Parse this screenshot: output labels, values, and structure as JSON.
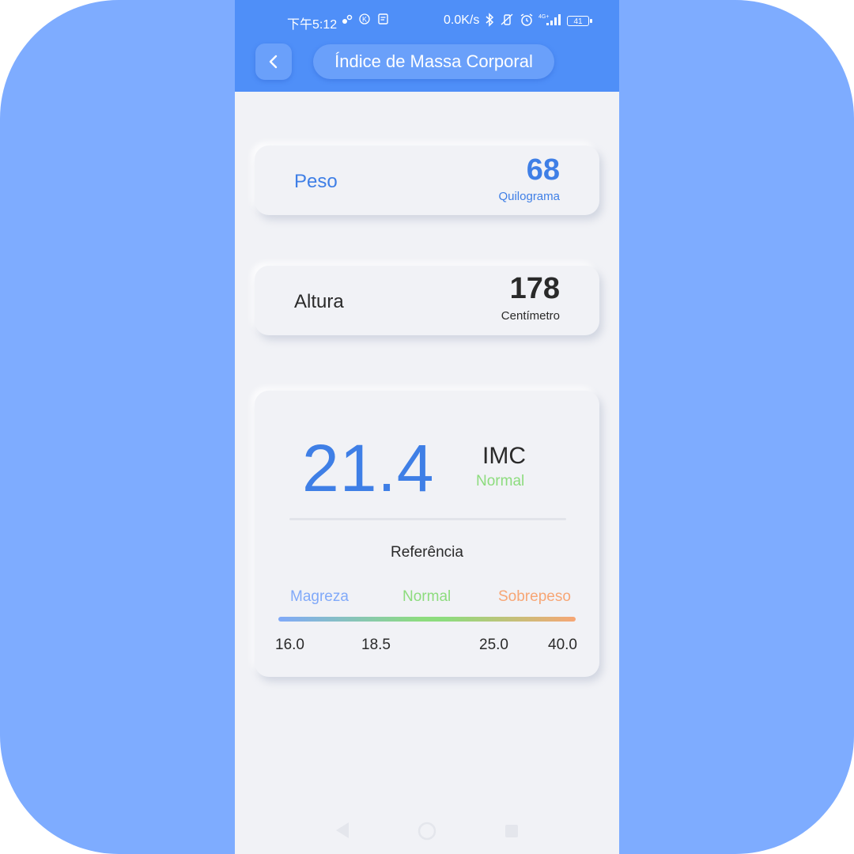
{
  "status_bar": {
    "time": "下午5:12",
    "net_speed": "0.0K/s",
    "signal_label": "4G+",
    "battery": "41"
  },
  "header": {
    "title": "Índice de Massa Corporal"
  },
  "weight": {
    "label": "Peso",
    "value": "68",
    "unit": "Quilograma"
  },
  "height": {
    "label": "Altura",
    "value": "178",
    "unit": "Centímetro"
  },
  "result": {
    "value": "21.4",
    "label": "IMC",
    "status": "Normal",
    "reference_title": "Referência",
    "categories": [
      "Magreza",
      "Normal",
      "Sobrepeso"
    ],
    "ticks": [
      "16.0",
      "18.5",
      "25.0",
      "40.0"
    ]
  },
  "colors": {
    "primary": "#4f8ff8",
    "underweight": "#80a9f9",
    "normal": "#8ddc7e",
    "overweight": "#f7a675"
  }
}
